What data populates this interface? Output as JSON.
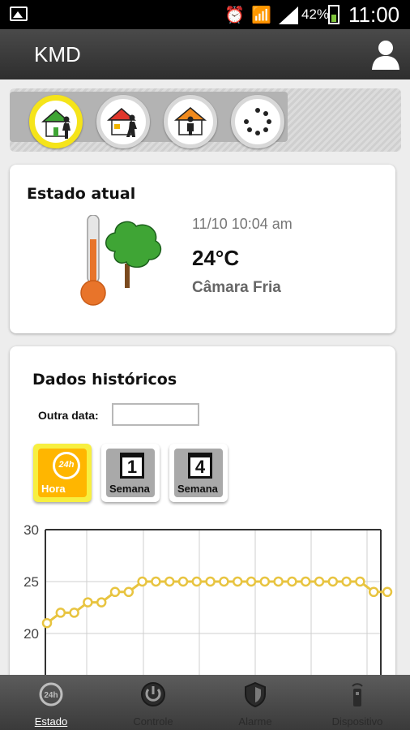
{
  "status_bar": {
    "battery": "42%",
    "time": "11:00"
  },
  "app": {
    "title": "KMD"
  },
  "modes": [
    {
      "name": "home-present",
      "roof_color": "#3fa535",
      "active": true
    },
    {
      "name": "home-away",
      "roof_color": "#e0362b",
      "active": false
    },
    {
      "name": "home-person",
      "roof_color": "#f08a1d",
      "active": false
    },
    {
      "name": "loading",
      "active": false
    }
  ],
  "current_state": {
    "title": "Estado atual",
    "datetime": "11/10 10:04 am",
    "temperature": "24°C",
    "location": "Câmara Fria",
    "thermometer_level": 0.75
  },
  "history": {
    "title": "Dados históricos",
    "date_label": "Outra data:",
    "date_value": "",
    "periods": [
      {
        "label": "Hora",
        "icon": "clock-24h-icon",
        "active": true
      },
      {
        "label": "Semana",
        "icon": "calendar-1-icon",
        "digit": "1",
        "active": false
      },
      {
        "label": "Semana",
        "icon": "calendar-4-icon",
        "digit": "4",
        "active": false
      }
    ]
  },
  "chart_data": {
    "type": "line",
    "y_ticks": [
      "30",
      "25",
      "20"
    ],
    "ylim": [
      15,
      30
    ],
    "grid": true,
    "color": "#e8c440",
    "series": [
      {
        "values": [
          21,
          22,
          22,
          23,
          23,
          24,
          24,
          25,
          25,
          25,
          25,
          25,
          25,
          25,
          25,
          25,
          25,
          25,
          25,
          25,
          25,
          25,
          25,
          25,
          24,
          24
        ]
      }
    ]
  },
  "bottom_nav": [
    {
      "label": "Estado",
      "icon": "clock-24h-icon",
      "active": true
    },
    {
      "label": "Controle",
      "icon": "power-icon",
      "active": false
    },
    {
      "label": "Alarme",
      "icon": "shield-icon",
      "active": false
    },
    {
      "label": "Dispositivo",
      "icon": "device-icon",
      "active": false
    }
  ]
}
